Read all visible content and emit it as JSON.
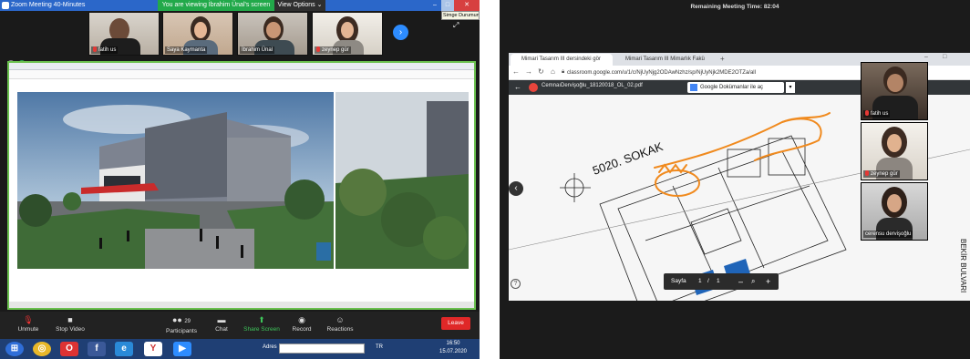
{
  "left": {
    "zoom_title": "Zoom Meeting 40-Minutes",
    "banner": "You are viewing İbrahim Ünal's screen",
    "view_options": "View Options ⌄",
    "tooltip": "Simge Durumuna",
    "participants": [
      {
        "name": "fatih us"
      },
      {
        "name": "Saya Kaymanta"
      },
      {
        "name": "İbrahim Ünal"
      },
      {
        "name": "zeynep gür"
      }
    ],
    "shared_doc_title": "",
    "controls": [
      {
        "label": "Unmute",
        "icon": "mic-muted-icon"
      },
      {
        "label": "Stop Video",
        "icon": "video-icon"
      },
      {
        "label": "Participants",
        "icon": "participants-icon",
        "count": "29"
      },
      {
        "label": "Chat",
        "icon": "chat-icon"
      },
      {
        "label": "Share Screen",
        "icon": "share-screen-icon"
      },
      {
        "label": "Record",
        "icon": "record-icon"
      },
      {
        "label": "Reactions",
        "icon": "reactions-icon"
      }
    ],
    "leave": "Leave",
    "taskbar": {
      "address_label": "Adres",
      "lang": "TR",
      "time": "16:50",
      "date": "15.07.2020"
    }
  },
  "right": {
    "remaining": "Remaining Meeting Time: 82:04",
    "tabs": [
      "Mimari Tasarım III dersindeki gör",
      "Mimari Tasarım III Mimarlık Fakü"
    ],
    "url": "classroom.google.com/u/1/c/NjUyNjg2ODAwNzhz/sp/NjUyNjk2MDE2OTZa/all",
    "pdf_name": "CemnaıDervişoğlu_18120018_OL_02.pdf",
    "open_with": "Google Dokümanlar ile aç",
    "drawing_label": "5020. SOKAK",
    "street_label": "BEKİR BULVARI",
    "page_label": "Sayfa",
    "page_current": "1",
    "page_sep": "/",
    "page_total": "1",
    "participants": [
      {
        "name": "fatih us"
      },
      {
        "name": "zeynep gür"
      },
      {
        "name": "cerensu dervişoğlu"
      }
    ]
  },
  "colors": {
    "zoom_blue": "#2d8cff",
    "share_green": "#22a94a",
    "leave_red": "#e02828",
    "sketch_orange": "#f08a1e"
  }
}
